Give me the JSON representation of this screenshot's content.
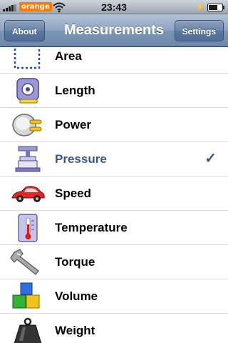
{
  "status_bar": {
    "carrier": "orange",
    "time": "23:43",
    "charging_symbol": "⚡"
  },
  "nav": {
    "title": "Measurements",
    "left_button": "About",
    "right_button": "Settings"
  },
  "items": [
    {
      "label": "Area",
      "icon": "area-icon"
    },
    {
      "label": "Length",
      "icon": "tape-measure-icon"
    },
    {
      "label": "Power",
      "icon": "power-plug-icon"
    },
    {
      "label": "Pressure",
      "icon": "press-icon",
      "selected": true
    },
    {
      "label": "Speed",
      "icon": "car-icon"
    },
    {
      "label": "Temperature",
      "icon": "thermometer-icon"
    },
    {
      "label": "Torque",
      "icon": "wrench-icon"
    },
    {
      "label": "Volume",
      "icon": "cubes-icon"
    },
    {
      "label": "Weight",
      "icon": "weight-icon"
    }
  ],
  "check_mark": "✓",
  "colors": {
    "nav_bar": "#7c95b5",
    "selected_text": "#395685",
    "carrier_badge": "#ff7a00"
  }
}
